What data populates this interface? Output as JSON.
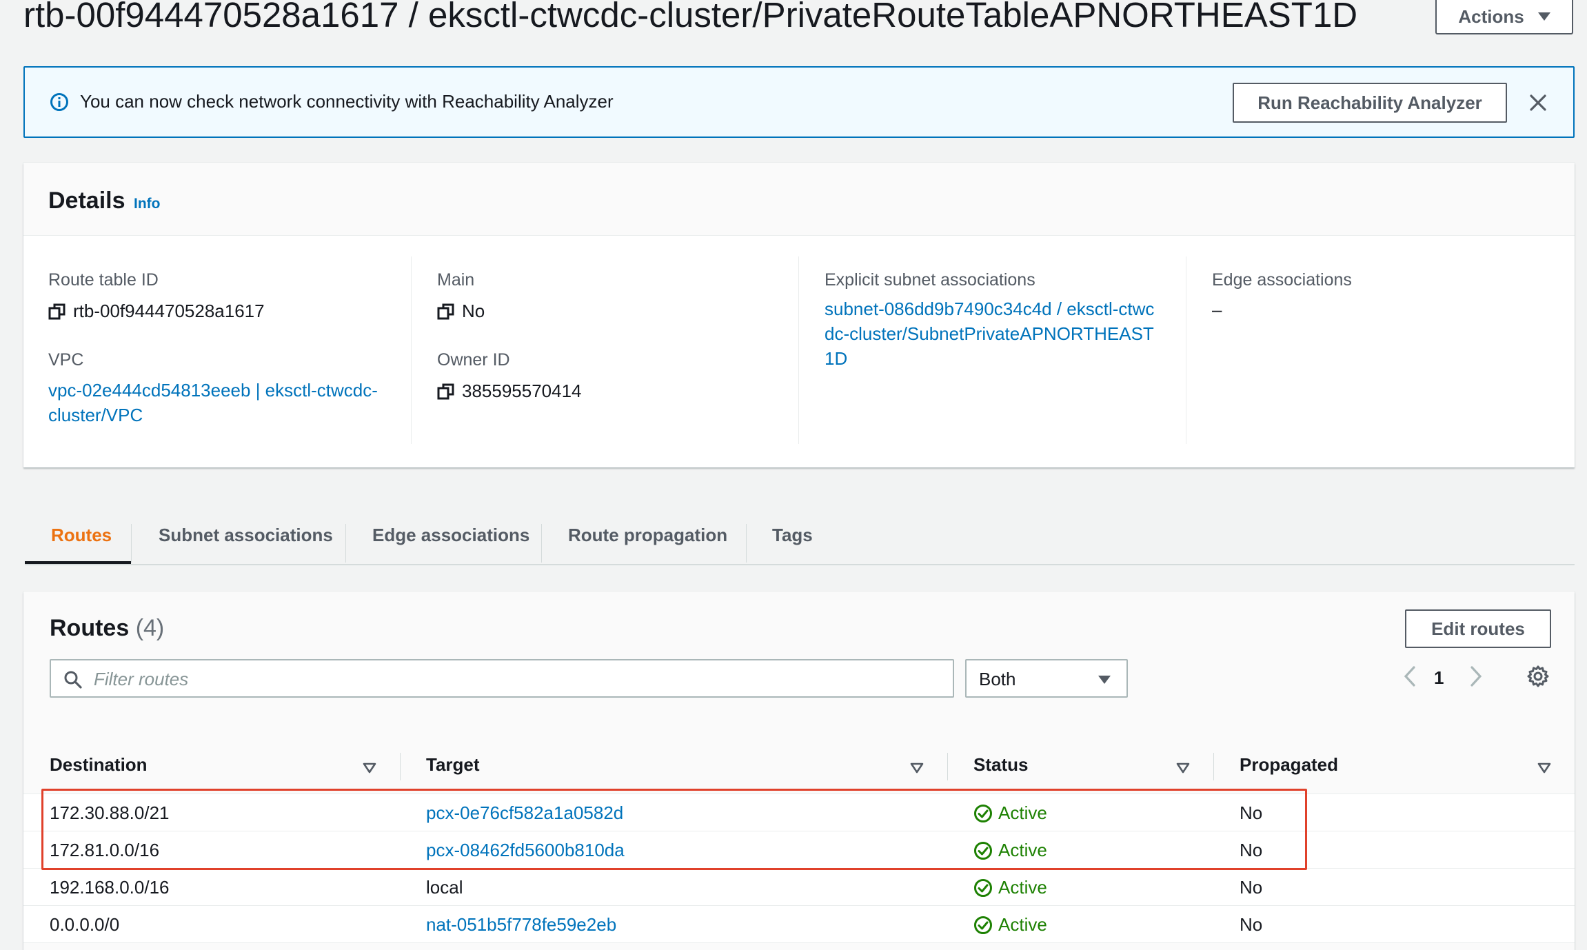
{
  "header": {
    "title": "rtb-00f944470528a1617 / eksctl-ctwcdc-cluster/PrivateRouteTableAPNORTHEAST1D",
    "actions_label": "Actions"
  },
  "flash": {
    "message": "You can now check network connectivity with Reachability Analyzer",
    "button_label": "Run Reachability Analyzer"
  },
  "details": {
    "title": "Details",
    "info_label": "Info",
    "route_table_id_label": "Route table ID",
    "route_table_id": "rtb-00f944470528a1617",
    "vpc_label": "VPC",
    "vpc_value": "vpc-02e444cd54813eeeb | eksctl-ctwcdc-cluster/VPC",
    "main_label": "Main",
    "main_value": "No",
    "owner_label": "Owner ID",
    "owner_value": "385595570414",
    "explicit_label": "Explicit subnet associations",
    "explicit_value": "subnet-086dd9b7490c34c4d / eksctl-ctwcdc-cluster/SubnetPrivateAPNORTHEAST1D",
    "edge_label": "Edge associations",
    "edge_value": "–"
  },
  "tabs": [
    "Routes",
    "Subnet associations",
    "Edge associations",
    "Route propagation",
    "Tags"
  ],
  "routes": {
    "title": "Routes",
    "count": "(4)",
    "edit_label": "Edit routes",
    "filter_placeholder": "Filter routes",
    "select_value": "Both",
    "page": "1",
    "columns": [
      "Destination",
      "Target",
      "Status",
      "Propagated"
    ],
    "rows": [
      {
        "destination": "172.30.88.0/21",
        "target": "pcx-0e76cf582a1a0582d",
        "target_link": true,
        "status": "Active",
        "propagated": "No"
      },
      {
        "destination": "172.81.0.0/16",
        "target": "pcx-08462fd5600b810da",
        "target_link": true,
        "status": "Active",
        "propagated": "No"
      },
      {
        "destination": "192.168.0.0/16",
        "target": "local",
        "target_link": false,
        "status": "Active",
        "propagated": "No"
      },
      {
        "destination": "0.0.0.0/0",
        "target": "nat-051b5f778fe59e2eb",
        "target_link": true,
        "status": "Active",
        "propagated": "No"
      }
    ]
  },
  "colors": {
    "link": "#0073bb",
    "active_tab": "#ec7211",
    "success": "#1d8102",
    "highlight": "#e0412b"
  }
}
